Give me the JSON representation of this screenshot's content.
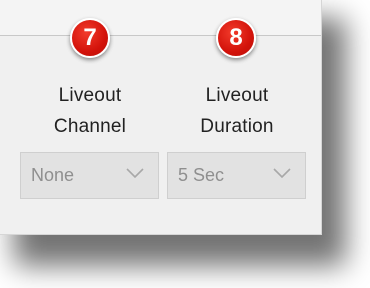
{
  "fields": [
    {
      "badge": "7",
      "label_line1": "Liveout",
      "label_line2": "Channel",
      "selected_value": "None"
    },
    {
      "badge": "8",
      "label_line1": "Liveout",
      "label_line2": "Duration",
      "selected_value": "5 Sec"
    }
  ],
  "colors": {
    "badge_red": "#d3130b",
    "panel_bg": "#f0f0f0",
    "select_bg": "#e2e2e2",
    "disabled_text": "#8f8f8f"
  },
  "icons": [
    "chevron-down-icon"
  ]
}
